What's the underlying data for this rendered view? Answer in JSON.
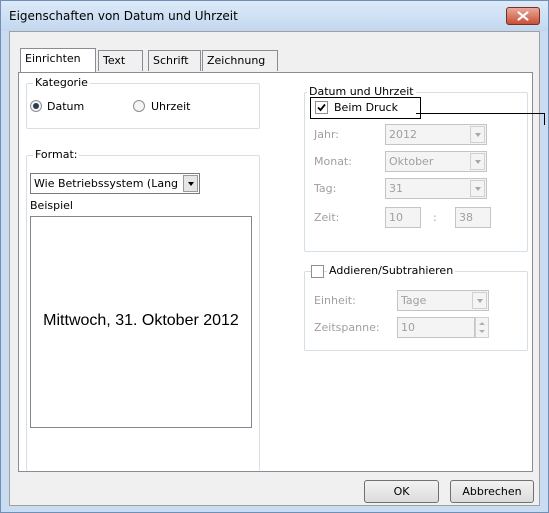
{
  "window": {
    "title": "Eigenschaften von Datum und Uhrzeit"
  },
  "tabs": [
    {
      "label": "Einrichten",
      "active": true
    },
    {
      "label": "Text",
      "active": false
    },
    {
      "label": "Schrift",
      "active": false
    },
    {
      "label": "Zeichnung",
      "active": false
    }
  ],
  "kategorie": {
    "legend": "Kategorie",
    "options": [
      {
        "label": "Datum",
        "checked": true
      },
      {
        "label": "Uhrzeit",
        "checked": false
      }
    ]
  },
  "format": {
    "legend": "Format:",
    "selected": "Wie Betriebssystem (Lang",
    "example_label": "Beispiel",
    "example_text": "Mittwoch, 31. Oktober 2012"
  },
  "datetime": {
    "legend": "Datum und Uhrzeit",
    "beim_druck_label": "Beim Druck",
    "beim_druck_checked": true,
    "jahr_label": "Jahr:",
    "jahr_value": "2012",
    "monat_label": "Monat:",
    "monat_value": "Oktober",
    "tag_label": "Tag:",
    "tag_value": "31",
    "zeit_label": "Zeit:",
    "zeit_hour": "10",
    "zeit_separator": ":",
    "zeit_minute": "38"
  },
  "addsub": {
    "legend": "Addieren/Subtrahieren",
    "checked": false,
    "einheit_label": "Einheit:",
    "einheit_value": "Tage",
    "zeitspanne_label": "Zeitspanne:",
    "zeitspanne_value": "10"
  },
  "buttons": {
    "ok": "OK",
    "cancel": "Abbrechen"
  }
}
